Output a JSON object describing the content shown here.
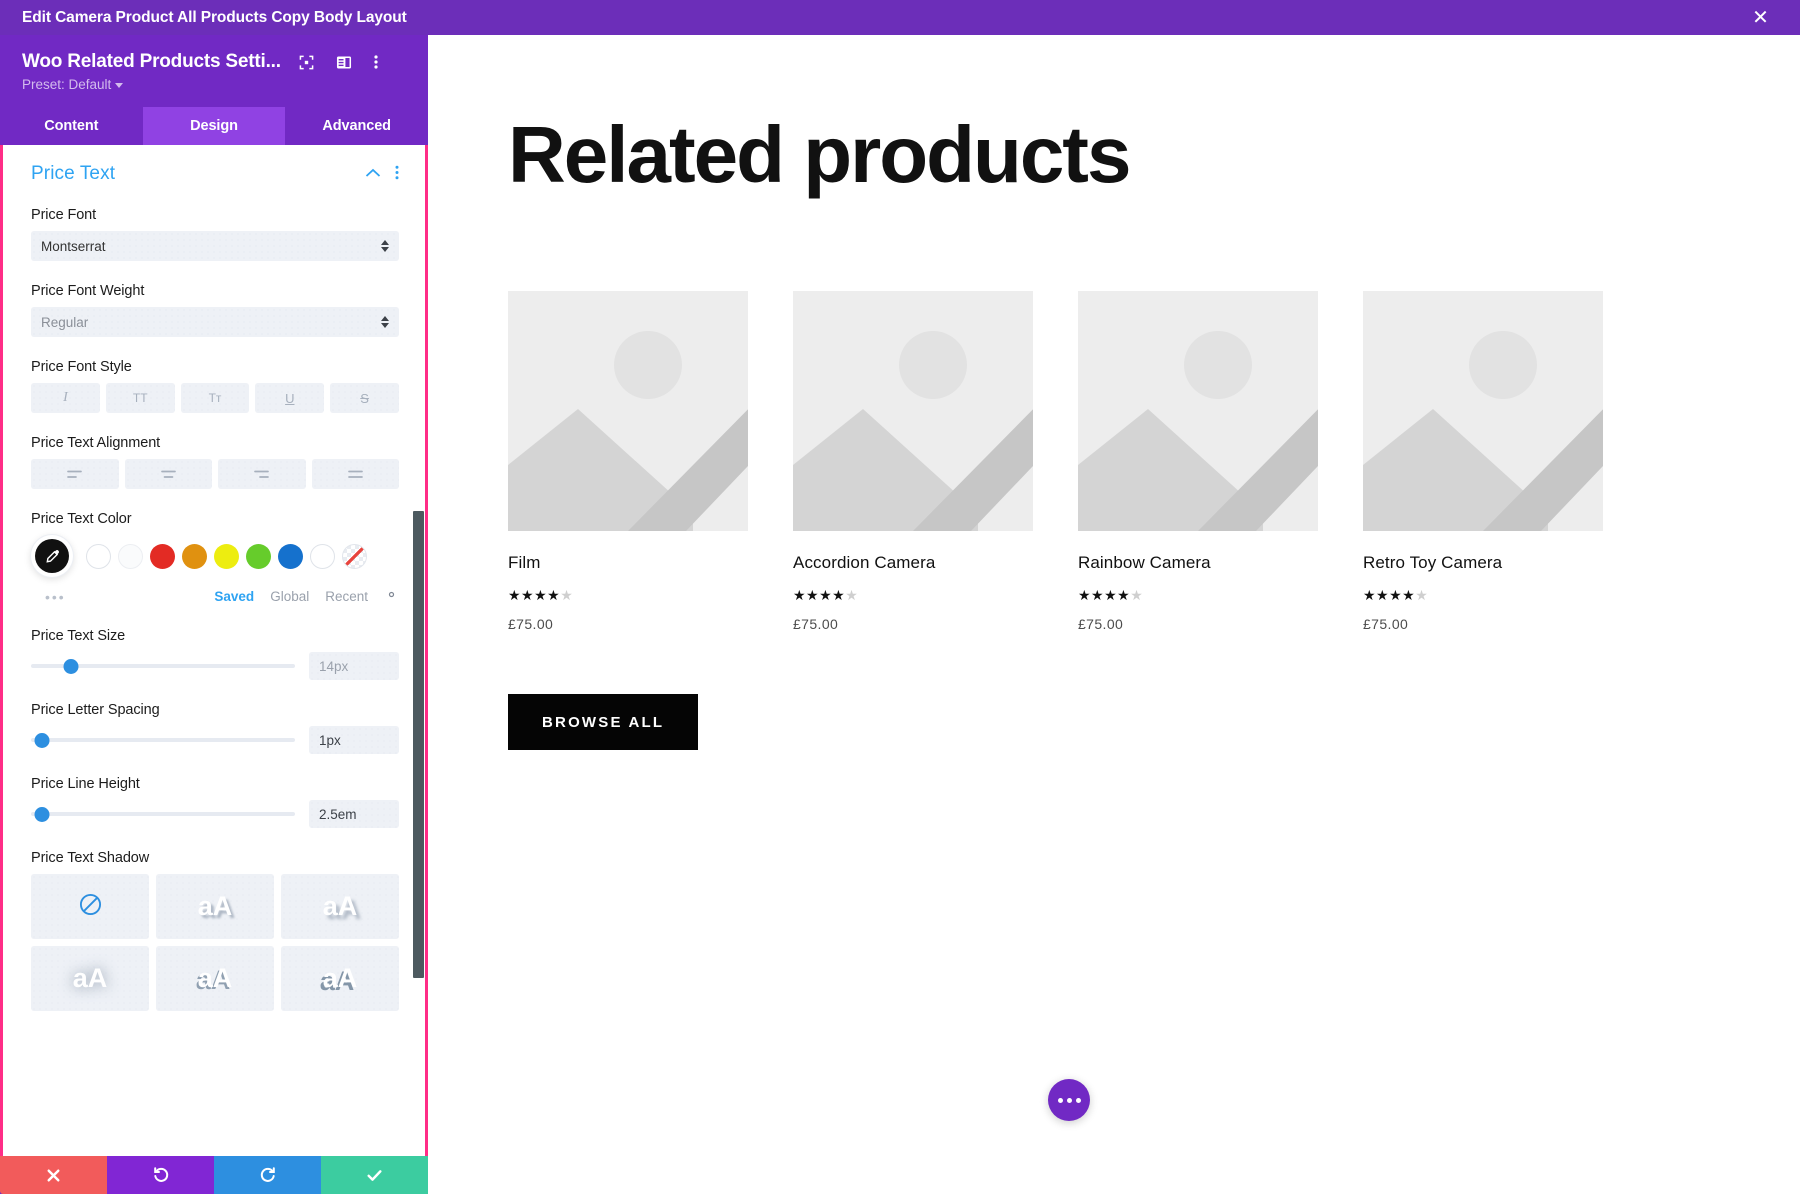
{
  "topbar": {
    "title": "Edit Camera Product All Products Copy Body Layout",
    "close_icon": "close-icon",
    "bg": "#6c2eb9"
  },
  "panel": {
    "module_title": "Woo Related Products Setti...",
    "preset_label": "Preset: Default",
    "header_icons": [
      "focus-icon",
      "layout-columns-icon",
      "kebab-menu-icon"
    ],
    "tabs": [
      {
        "label": "Content",
        "active": false
      },
      {
        "label": "Design",
        "active": true
      },
      {
        "label": "Advanced",
        "active": false
      }
    ],
    "section": {
      "title": "Price Text",
      "collapse_icon": "chevron-up-icon",
      "options_icon": "kebab-menu-icon"
    },
    "fields": {
      "price_font": {
        "label": "Price Font",
        "value": "Montserrat"
      },
      "price_font_weight": {
        "label": "Price Font Weight",
        "value": "Regular"
      },
      "price_font_style": {
        "label": "Price Font Style",
        "options": [
          {
            "glyph": "I",
            "name": "italic-button"
          },
          {
            "glyph": "TT",
            "name": "uppercase-button"
          },
          {
            "glyph": "Tᴛ",
            "name": "small-caps-button"
          },
          {
            "glyph": "U",
            "name": "underline-button"
          },
          {
            "glyph": "S",
            "name": "strikethrough-button"
          }
        ]
      },
      "price_text_alignment": {
        "label": "Price Text Alignment",
        "options": [
          {
            "glyph": "≡",
            "name": "align-left-button"
          },
          {
            "glyph": "≡",
            "name": "align-center-button"
          },
          {
            "glyph": "≡",
            "name": "align-right-button"
          },
          {
            "glyph": "≡",
            "name": "align-justify-button"
          }
        ]
      },
      "price_text_color": {
        "label": "Price Text Color",
        "picker_icon": "eyedropper-icon",
        "more_icon": "more-dots-icon",
        "swatches": [
          {
            "name": "swatch-white-1",
            "color": "#ffffff",
            "style": "outline"
          },
          {
            "name": "swatch-white-2",
            "color": "#fafbfc",
            "style": "outline2"
          },
          {
            "name": "swatch-red",
            "color": "#e32b24",
            "style": "solid"
          },
          {
            "name": "swatch-orange",
            "color": "#e09110",
            "style": "solid"
          },
          {
            "name": "swatch-yellow",
            "color": "#eded10",
            "style": "solid"
          },
          {
            "name": "swatch-green",
            "color": "#66cc2b",
            "style": "solid"
          },
          {
            "name": "swatch-blue",
            "color": "#1571cd",
            "style": "solid"
          },
          {
            "name": "swatch-white-3",
            "color": "#ffffff",
            "style": "outline"
          },
          {
            "name": "swatch-transparent",
            "color": "transparent",
            "style": "transparent"
          }
        ],
        "tabs": [
          {
            "label": "Saved",
            "active": true
          },
          {
            "label": "Global",
            "active": false
          },
          {
            "label": "Recent",
            "active": false
          }
        ],
        "settings_icon": "gear-icon"
      },
      "price_text_size": {
        "label": "Price Text Size",
        "value": "14px",
        "knob_pct": 15
      },
      "price_letter_spacing": {
        "label": "Price Letter Spacing",
        "value": "1px",
        "knob_pct": 3
      },
      "price_line_height": {
        "label": "Price Line Height",
        "value": "2.5em",
        "knob_pct": 4
      },
      "price_text_shadow": {
        "label": "Price Text Shadow",
        "options": [
          {
            "name": "shadow-none",
            "glyph": "⃠",
            "kind": "none"
          },
          {
            "name": "shadow-preset-1",
            "glyph": "aA",
            "kind": "shadow",
            "shadow": "3px 3px 2px rgba(120,135,155,0.55)"
          },
          {
            "name": "shadow-preset-2",
            "glyph": "aA",
            "kind": "shadow",
            "shadow": "4px 4px 3px rgba(120,135,155,0.55)"
          },
          {
            "name": "shadow-preset-3",
            "glyph": "aA",
            "kind": "shadow",
            "shadow": "0px 0px 14px rgba(120,135,155,0.75)"
          },
          {
            "name": "shadow-preset-4",
            "glyph": "aA",
            "kind": "shadow",
            "shadow": "-2px 2px 0px rgba(120,140,160,0.75)"
          },
          {
            "name": "shadow-preset-5",
            "glyph": "aA",
            "kind": "shadow",
            "shadow": "-3px 3px 0px rgba(120,140,160,0.85)"
          }
        ]
      }
    },
    "actions": [
      {
        "name": "cancel-button",
        "glyph": "✕",
        "color": "#f25b5b"
      },
      {
        "name": "undo-button",
        "glyph": "↺",
        "color": "#8126d4"
      },
      {
        "name": "redo-button",
        "glyph": "↻",
        "color": "#2d8fe0"
      },
      {
        "name": "save-button",
        "glyph": "✓",
        "color": "#3ccca0"
      }
    ]
  },
  "preview": {
    "heading": "Related products",
    "products": [
      {
        "name": "Film",
        "stars_on": 4,
        "stars_off": 1,
        "price": "£75.00"
      },
      {
        "name": "Accordion Camera",
        "stars_on": 4,
        "stars_off": 1,
        "price": "£75.00"
      },
      {
        "name": "Rainbow Camera",
        "stars_on": 4,
        "stars_off": 1,
        "price": "£75.00"
      },
      {
        "name": "Retro Toy Camera",
        "stars_on": 4,
        "stars_off": 1,
        "price": "£75.00"
      }
    ],
    "browse_all_label": "BROWSE ALL",
    "fab_icon": "more-dots-icon"
  }
}
